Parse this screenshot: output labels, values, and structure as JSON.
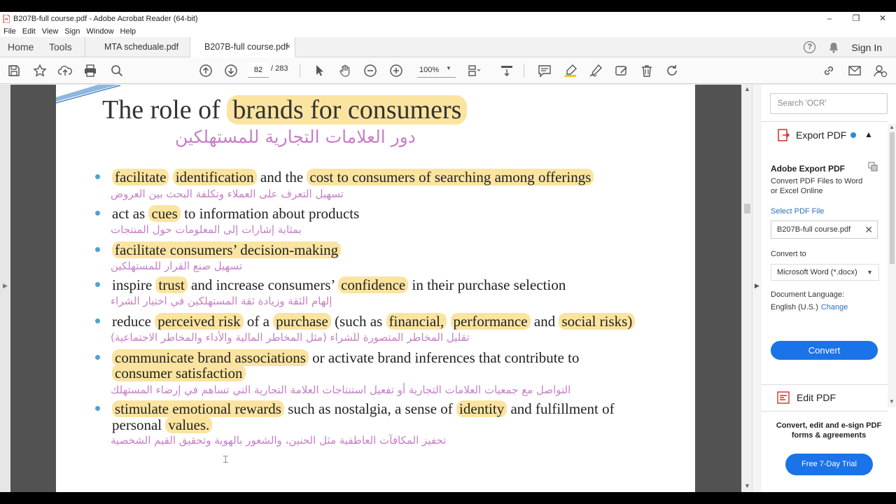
{
  "window": {
    "title": "B207B-full course.pdf - Adobe Acrobat Reader (64-bit)",
    "controls": [
      "–",
      "❐",
      "✕"
    ]
  },
  "menu": [
    "File",
    "Edit",
    "View",
    "Sign",
    "Window",
    "Help"
  ],
  "tabs": {
    "home": "Home",
    "tools": "Tools",
    "docs": [
      {
        "label": "MTA scheduale.pdf",
        "active": false
      },
      {
        "label": "B207B-full course.pdf",
        "active": true
      }
    ],
    "close": "×",
    "help": "?",
    "signin": "Sign In"
  },
  "toolbar": {
    "page_current": "82",
    "page_total": "/ 283",
    "zoom": "100%",
    "icons": [
      "save-icon",
      "star-icon",
      "upload-icon",
      "print-icon",
      "search-icon",
      "page-up-icon",
      "page-down-icon",
      "select-cursor-icon",
      "hand-icon",
      "zoom-out-icon",
      "zoom-in-icon",
      "page-display-icon",
      "scroll-mode-icon",
      "comment-icon",
      "highlight-icon",
      "sign-icon",
      "edit-icon",
      "delete-icon",
      "rotate-icon",
      "link-icon",
      "mail-icon",
      "user-icon"
    ]
  },
  "slide": {
    "title_plain": "The role of ",
    "title_hl": "brands for consumers",
    "subtitle_ar": "دور العلامات التجارية للمستهلكين",
    "bullets": [
      {
        "segments": [
          {
            "t": "facilitate",
            "h": true
          },
          {
            "t": " ",
            "h": false
          },
          {
            "t": "identification",
            "h": true
          },
          {
            "t": " and the ",
            "h": false
          },
          {
            "t": "cost to consumers of  searching among offerings",
            "h": true
          }
        ],
        "ar": "تسهيل التعرف على العملاء وتكلفة البحث بين العروض"
      },
      {
        "segments": [
          {
            "t": "act as ",
            "h": false
          },
          {
            "t": "cues",
            "h": true
          },
          {
            "t": " to information about products",
            "h": false
          }
        ],
        "ar": "بمثابة إشارات إلى المعلومات حول المنتجات"
      },
      {
        "segments": [
          {
            "t": "facilitate consumers’ decision-making",
            "h": true
          }
        ],
        "ar": "تسهيل صنع القرار للمستهلكين"
      },
      {
        "segments": [
          {
            "t": "inspire ",
            "h": false
          },
          {
            "t": "trust",
            "h": true
          },
          {
            "t": " and increase consumers’ ",
            "h": false
          },
          {
            "t": "confidence",
            "h": true
          },
          {
            "t": " in their purchase selection",
            "h": false
          }
        ],
        "ar": "إلهام الثقة وزيادة ثقة المستهلكين في اختيار الشراء"
      },
      {
        "segments": [
          {
            "t": "reduce ",
            "h": false
          },
          {
            "t": "perceived risk",
            "h": true
          },
          {
            "t": " of a ",
            "h": false
          },
          {
            "t": "purchase",
            "h": true
          },
          {
            "t": " (such as ",
            "h": false
          },
          {
            "t": "financial,",
            "h": true
          },
          {
            "t": " ",
            "h": false
          },
          {
            "t": "performance",
            "h": true
          },
          {
            "t": " and ",
            "h": false
          },
          {
            "t": "social risks)",
            "h": true
          }
        ],
        "ar": "تقليل المخاطر المتصورة للشراء (مثل المخاطر المالية والأداء والمخاطر الاجتماعية)"
      },
      {
        "segments": [
          {
            "t": "communicate brand associations",
            "h": true
          },
          {
            "t": " or activate brand inferences that contribute to",
            "h": false
          }
        ],
        "line2": [
          {
            "t": "consumer satisfaction",
            "h": true
          }
        ],
        "ar": "التواصل مع جمعيات العلامات التجارية أو تفعيل استنتاجات العلامة التجارية التي تساهم في إرضاء المستهلك"
      },
      {
        "segments": [
          {
            "t": "stimulate emotional rewards",
            "h": true
          },
          {
            "t": " such as nostalgia, a sense of ",
            "h": false
          },
          {
            "t": "identity",
            "h": true
          },
          {
            "t": " and fulfillment of",
            "h": false
          }
        ],
        "line2": [
          {
            "t": "personal ",
            "h": false
          },
          {
            "t": "values.",
            "h": true
          }
        ],
        "ar": "تحفيز المكافآت العاطفية مثل الحنين، والشعور بالهوية وتحقيق القيم الشخصية"
      }
    ]
  },
  "right_panel": {
    "search_placeholder": "Search 'OCR'",
    "export_label": "Export PDF",
    "export_heading": "Adobe Export PDF",
    "export_desc": "Convert PDF Files to Word or Excel Online",
    "select_file": "Select PDF File",
    "file_name": "B207B-full course.pdf",
    "convert_to": "Convert to",
    "format": "Microsoft Word (*.docx)",
    "doc_lang_label": "Document Language:",
    "doc_lang": "English (U.S.)",
    "change": "Change",
    "convert_btn": "Convert",
    "edit_label": "Edit PDF",
    "promo": "Convert, edit and e-sign PDF forms & agreements",
    "trial_btn": "Free 7-Day Trial"
  },
  "colors": {
    "highlight": "#fbe4a0",
    "arabic_text": "#c77fc7",
    "bullet": "#4aa3d8",
    "accent": "#1a73e8"
  }
}
